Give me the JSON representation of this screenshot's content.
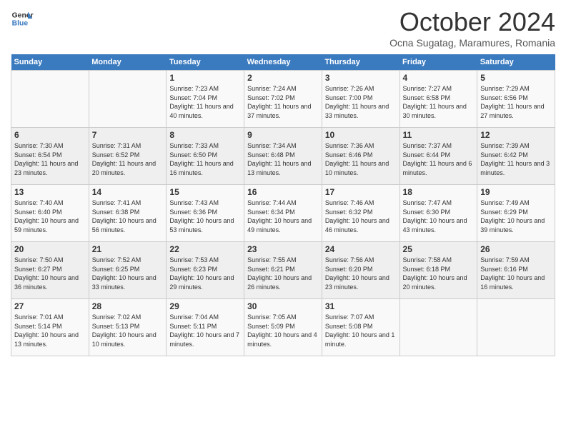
{
  "header": {
    "logo_line1": "General",
    "logo_line2": "Blue",
    "month_title": "October 2024",
    "subtitle": "Ocna Sugatag, Maramures, Romania"
  },
  "weekdays": [
    "Sunday",
    "Monday",
    "Tuesday",
    "Wednesday",
    "Thursday",
    "Friday",
    "Saturday"
  ],
  "weeks": [
    [
      {
        "day": "",
        "info": ""
      },
      {
        "day": "",
        "info": ""
      },
      {
        "day": "1",
        "info": "Sunrise: 7:23 AM\nSunset: 7:04 PM\nDaylight: 11 hours and 40 minutes."
      },
      {
        "day": "2",
        "info": "Sunrise: 7:24 AM\nSunset: 7:02 PM\nDaylight: 11 hours and 37 minutes."
      },
      {
        "day": "3",
        "info": "Sunrise: 7:26 AM\nSunset: 7:00 PM\nDaylight: 11 hours and 33 minutes."
      },
      {
        "day": "4",
        "info": "Sunrise: 7:27 AM\nSunset: 6:58 PM\nDaylight: 11 hours and 30 minutes."
      },
      {
        "day": "5",
        "info": "Sunrise: 7:29 AM\nSunset: 6:56 PM\nDaylight: 11 hours and 27 minutes."
      }
    ],
    [
      {
        "day": "6",
        "info": "Sunrise: 7:30 AM\nSunset: 6:54 PM\nDaylight: 11 hours and 23 minutes."
      },
      {
        "day": "7",
        "info": "Sunrise: 7:31 AM\nSunset: 6:52 PM\nDaylight: 11 hours and 20 minutes."
      },
      {
        "day": "8",
        "info": "Sunrise: 7:33 AM\nSunset: 6:50 PM\nDaylight: 11 hours and 16 minutes."
      },
      {
        "day": "9",
        "info": "Sunrise: 7:34 AM\nSunset: 6:48 PM\nDaylight: 11 hours and 13 minutes."
      },
      {
        "day": "10",
        "info": "Sunrise: 7:36 AM\nSunset: 6:46 PM\nDaylight: 11 hours and 10 minutes."
      },
      {
        "day": "11",
        "info": "Sunrise: 7:37 AM\nSunset: 6:44 PM\nDaylight: 11 hours and 6 minutes."
      },
      {
        "day": "12",
        "info": "Sunrise: 7:39 AM\nSunset: 6:42 PM\nDaylight: 11 hours and 3 minutes."
      }
    ],
    [
      {
        "day": "13",
        "info": "Sunrise: 7:40 AM\nSunset: 6:40 PM\nDaylight: 10 hours and 59 minutes."
      },
      {
        "day": "14",
        "info": "Sunrise: 7:41 AM\nSunset: 6:38 PM\nDaylight: 10 hours and 56 minutes."
      },
      {
        "day": "15",
        "info": "Sunrise: 7:43 AM\nSunset: 6:36 PM\nDaylight: 10 hours and 53 minutes."
      },
      {
        "day": "16",
        "info": "Sunrise: 7:44 AM\nSunset: 6:34 PM\nDaylight: 10 hours and 49 minutes."
      },
      {
        "day": "17",
        "info": "Sunrise: 7:46 AM\nSunset: 6:32 PM\nDaylight: 10 hours and 46 minutes."
      },
      {
        "day": "18",
        "info": "Sunrise: 7:47 AM\nSunset: 6:30 PM\nDaylight: 10 hours and 43 minutes."
      },
      {
        "day": "19",
        "info": "Sunrise: 7:49 AM\nSunset: 6:29 PM\nDaylight: 10 hours and 39 minutes."
      }
    ],
    [
      {
        "day": "20",
        "info": "Sunrise: 7:50 AM\nSunset: 6:27 PM\nDaylight: 10 hours and 36 minutes."
      },
      {
        "day": "21",
        "info": "Sunrise: 7:52 AM\nSunset: 6:25 PM\nDaylight: 10 hours and 33 minutes."
      },
      {
        "day": "22",
        "info": "Sunrise: 7:53 AM\nSunset: 6:23 PM\nDaylight: 10 hours and 29 minutes."
      },
      {
        "day": "23",
        "info": "Sunrise: 7:55 AM\nSunset: 6:21 PM\nDaylight: 10 hours and 26 minutes."
      },
      {
        "day": "24",
        "info": "Sunrise: 7:56 AM\nSunset: 6:20 PM\nDaylight: 10 hours and 23 minutes."
      },
      {
        "day": "25",
        "info": "Sunrise: 7:58 AM\nSunset: 6:18 PM\nDaylight: 10 hours and 20 minutes."
      },
      {
        "day": "26",
        "info": "Sunrise: 7:59 AM\nSunset: 6:16 PM\nDaylight: 10 hours and 16 minutes."
      }
    ],
    [
      {
        "day": "27",
        "info": "Sunrise: 7:01 AM\nSunset: 5:14 PM\nDaylight: 10 hours and 13 minutes."
      },
      {
        "day": "28",
        "info": "Sunrise: 7:02 AM\nSunset: 5:13 PM\nDaylight: 10 hours and 10 minutes."
      },
      {
        "day": "29",
        "info": "Sunrise: 7:04 AM\nSunset: 5:11 PM\nDaylight: 10 hours and 7 minutes."
      },
      {
        "day": "30",
        "info": "Sunrise: 7:05 AM\nSunset: 5:09 PM\nDaylight: 10 hours and 4 minutes."
      },
      {
        "day": "31",
        "info": "Sunrise: 7:07 AM\nSunset: 5:08 PM\nDaylight: 10 hours and 1 minute."
      },
      {
        "day": "",
        "info": ""
      },
      {
        "day": "",
        "info": ""
      }
    ]
  ]
}
